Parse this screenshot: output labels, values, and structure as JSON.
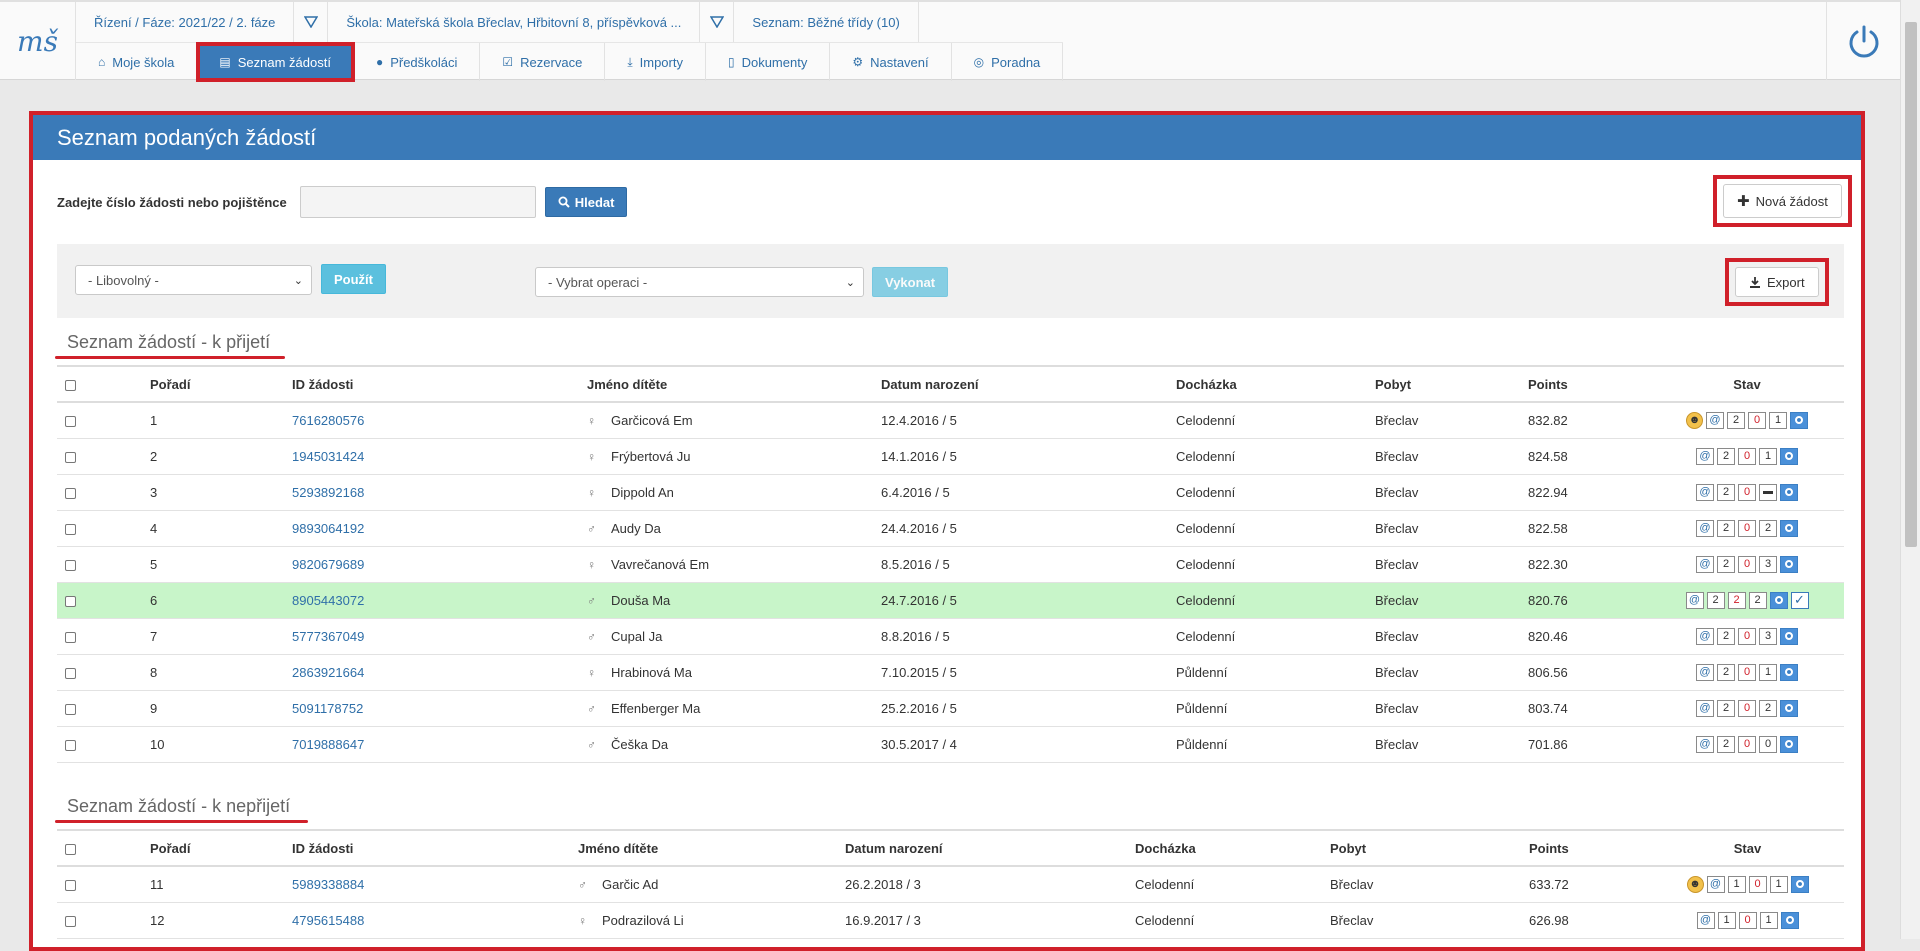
{
  "header": {
    "logo_text": "mš",
    "info": {
      "phase": "Řízení / Fáze: 2021/22 / 2. fáze",
      "school": "Škola: Mateřská škola Břeclav, Hřbitovní 8, příspěvková ...",
      "list": "Seznam: Běžné třídy (10)"
    },
    "nav": [
      {
        "label": "Moje škola",
        "icon": "home-icon"
      },
      {
        "label": "Seznam žádostí",
        "icon": "document-icon",
        "active": true
      },
      {
        "label": "Předškoláci",
        "icon": "user-icon"
      },
      {
        "label": "Rezervace",
        "icon": "checkbox-edit-icon"
      },
      {
        "label": "Importy",
        "icon": "download-icon"
      },
      {
        "label": "Dokumenty",
        "icon": "file-icon"
      },
      {
        "label": "Nastavení",
        "icon": "gears-icon"
      },
      {
        "label": "Poradna",
        "icon": "lifebuoy-icon"
      }
    ]
  },
  "panel": {
    "title": "Seznam podaných žádostí",
    "search_label": "Zadejte číslo žádosti nebo pojištěnce",
    "search_button": "Hledat",
    "new_button": "Nová žádost",
    "filter_select": "- Libovolný -",
    "apply_button": "Použít",
    "operation_select": "- Vybrat operaci -",
    "execute_button": "Vykonat",
    "export_button": "Export"
  },
  "columns": {
    "order": "Pořadí",
    "id": "ID žádosti",
    "name": "Jméno dítěte",
    "birth": "Datum narození",
    "attendance": "Docházka",
    "stay": "Pobyt",
    "points": "Points",
    "status": "Stav"
  },
  "accepted": {
    "title": "Seznam žádostí - k přijetí",
    "rows": [
      {
        "order": "1",
        "id": "7616280576",
        "sex": "♀",
        "name": "Garčicová Em",
        "birth": "12.4.2016 / 5",
        "attendance": "Celodenní",
        "stay": "Břeclav",
        "points": "832.82",
        "warn": true,
        "n1": "2",
        "n2": "0",
        "n3": "1"
      },
      {
        "order": "2",
        "id": "1945031424",
        "sex": "♀",
        "name": "Frýbertová Ju",
        "birth": "14.1.2016 / 5",
        "attendance": "Celodenní",
        "stay": "Břeclav",
        "points": "824.58",
        "n1": "2",
        "n2": "0",
        "n3": "1"
      },
      {
        "order": "3",
        "id": "5293892168",
        "sex": "♀",
        "name": "Dippold An",
        "birth": "6.4.2016 / 5",
        "attendance": "Celodenní",
        "stay": "Břeclav",
        "points": "822.94",
        "n1": "2",
        "n2": "0",
        "n3": ""
      },
      {
        "order": "4",
        "id": "9893064192",
        "sex": "♂",
        "name": "Audy Da",
        "birth": "24.4.2016 / 5",
        "attendance": "Celodenní",
        "stay": "Břeclav",
        "points": "822.58",
        "n1": "2",
        "n2": "0",
        "n3": "2"
      },
      {
        "order": "5",
        "id": "9820679689",
        "sex": "♀",
        "name": "Vavrečanová Em",
        "birth": "8.5.2016 / 5",
        "attendance": "Celodenní",
        "stay": "Břeclav",
        "points": "822.30",
        "n1": "2",
        "n2": "0",
        "n3": "3"
      },
      {
        "order": "6",
        "id": "8905443072",
        "sex": "♂",
        "name": "Douša Ma",
        "birth": "24.7.2016 / 5",
        "attendance": "Celodenní",
        "stay": "Břeclav",
        "points": "820.76",
        "n1": "2",
        "n2": "2",
        "n3": "2",
        "check": true,
        "highlight": true
      },
      {
        "order": "7",
        "id": "5777367049",
        "sex": "♂",
        "name": "Cupal Ja",
        "birth": "8.8.2016 / 5",
        "attendance": "Celodenní",
        "stay": "Břeclav",
        "points": "820.46",
        "n1": "2",
        "n2": "0",
        "n3": "3"
      },
      {
        "order": "8",
        "id": "2863921664",
        "sex": "♀",
        "name": "Hrabinová Ma",
        "birth": "7.10.2015 / 5",
        "attendance": "Půldenní",
        "stay": "Břeclav",
        "points": "806.56",
        "n1": "2",
        "n2": "0",
        "n3": "1"
      },
      {
        "order": "9",
        "id": "5091178752",
        "sex": "♂",
        "name": "Effenberger Ma",
        "birth": "25.2.2016 / 5",
        "attendance": "Půldenní",
        "stay": "Břeclav",
        "points": "803.74",
        "n1": "2",
        "n2": "0",
        "n3": "2"
      },
      {
        "order": "10",
        "id": "7019888647",
        "sex": "♂",
        "name": "Češka Da",
        "birth": "30.5.2017 / 4",
        "attendance": "Půldenní",
        "stay": "Břeclav",
        "points": "701.86",
        "n1": "2",
        "n2": "0",
        "n3": "0"
      }
    ]
  },
  "rejected": {
    "title": "Seznam žádostí - k nepřijetí",
    "rows": [
      {
        "order": "11",
        "id": "5989338884",
        "sex": "♂",
        "name": "Garčic Ad",
        "birth": "26.2.2018 / 3",
        "attendance": "Celodenní",
        "stay": "Břeclav",
        "points": "633.72",
        "warn": true,
        "n1": "1",
        "n2": "0",
        "n3": "1"
      },
      {
        "order": "12",
        "id": "4795615488",
        "sex": "♀",
        "name": "Podrazilová Li",
        "birth": "16.9.2017 / 3",
        "attendance": "Celodenní",
        "stay": "Břeclav",
        "points": "626.98",
        "n1": "1",
        "n2": "0",
        "n3": "1"
      }
    ]
  }
}
